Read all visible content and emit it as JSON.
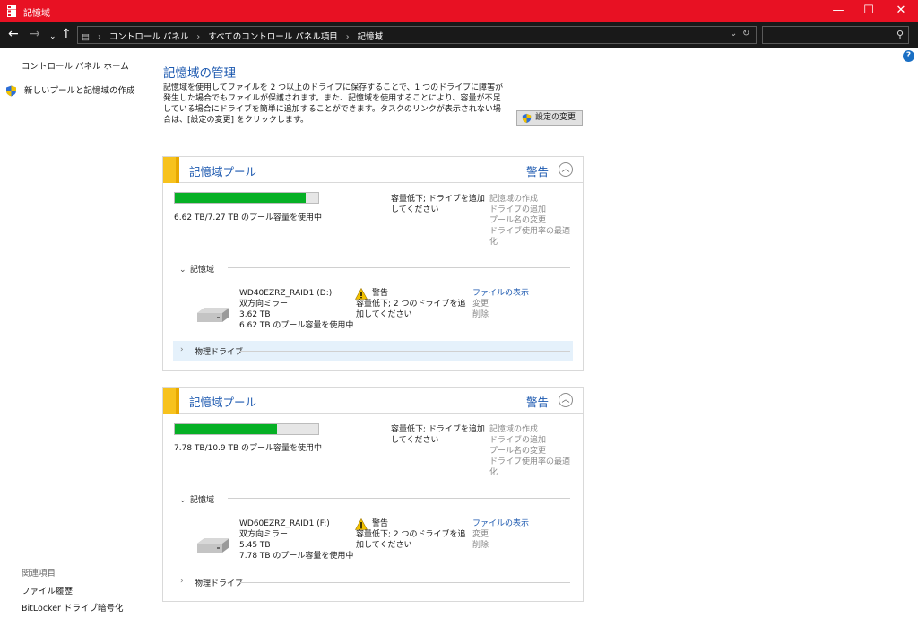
{
  "window": {
    "title": "記憶域",
    "minimize": "—",
    "maximize": "☐",
    "close": "✕"
  },
  "address": {
    "crumbs": [
      "コントロール パネル",
      "すべてのコントロール パネル項目",
      "記憶域"
    ],
    "search_placeholder": ""
  },
  "sidebar": {
    "home": "コントロール パネル ホーム",
    "new_pool": "新しいプールと記憶域の作成",
    "related_title": "関連項目",
    "related": [
      "ファイル履歴",
      "BitLocker ドライブ暗号化"
    ]
  },
  "main": {
    "title": "記憶域の管理",
    "description": "記憶域を使用してファイルを 2 つ以上のドライブに保存することで、1 つのドライブに障害が発生した場合でもファイルが保護されます。また、記憶域を使用することにより、容量が不足している場合にドライブを簡単に追加することができます。タスクのリンクが表示されない場合は、[設定の変更] をクリックします。",
    "change_settings": "設定の変更"
  },
  "pools": [
    {
      "title": "記憶域プール",
      "warning": "警告",
      "usage_fraction": 0.911,
      "usage_text": "6.62 TB/7.27 TB のプール容量を使用中",
      "status": "容量低下; ドライブを追加してください",
      "actions": [
        "記憶域の作成",
        "ドライブの追加",
        "プール名の変更",
        "ドライブ使用率の最適化"
      ],
      "spaces_label": "記憶域",
      "drive": {
        "name": "WD40EZRZ_RAID1 (D:)",
        "resiliency": "双方向ミラー",
        "size": "3.62 TB",
        "used": "6.62 TB のプール容量を使用中",
        "warn_label": "警告",
        "warn_text": "容量低下; 2 つのドライブを追加してください",
        "actions": [
          "ファイルの表示",
          "変更",
          "削除"
        ]
      },
      "physical_label": "物理ドライブ"
    },
    {
      "title": "記憶域プール",
      "warning": "警告",
      "usage_fraction": 0.714,
      "usage_text": "7.78 TB/10.9 TB のプール容量を使用中",
      "status": "容量低下; ドライブを追加してください",
      "actions": [
        "記憶域の作成",
        "ドライブの追加",
        "プール名の変更",
        "ドライブ使用率の最適化"
      ],
      "spaces_label": "記憶域",
      "drive": {
        "name": "WD60EZRZ_RAID1 (F:)",
        "resiliency": "双方向ミラー",
        "size": "5.45 TB",
        "used": "7.78 TB のプール容量を使用中",
        "warn_label": "警告",
        "warn_text": "容量低下; 2 つのドライブを追加してください",
        "actions": [
          "ファイルの表示",
          "変更",
          "削除"
        ]
      },
      "physical_label": "物理ドライブ"
    }
  ],
  "colors": {
    "titlebar": "#e81123",
    "link": "#1e5ab0",
    "bar_fill": "#06b025",
    "pool_stripe": "#f7c21d"
  }
}
